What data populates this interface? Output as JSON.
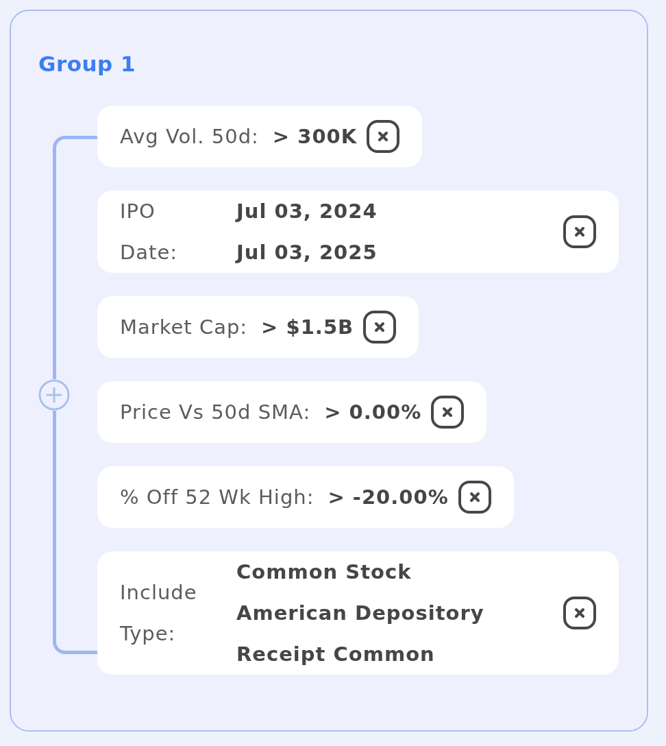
{
  "group": {
    "title": "Group 1",
    "filters": [
      {
        "label": "Avg Vol. 50d:",
        "values": [
          "> 300K"
        ]
      },
      {
        "label": "IPO Date:",
        "values": [
          "Jul 03, 2024",
          "Jul 03, 2025"
        ]
      },
      {
        "label": "Market Cap:",
        "values": [
          "> $1.5B"
        ]
      },
      {
        "label": "Price Vs 50d SMA:",
        "values": [
          "> 0.00%"
        ]
      },
      {
        "label": "% Off 52 Wk High:",
        "values": [
          "> -20.00%"
        ]
      },
      {
        "label": "Include Type:",
        "values": [
          "Common Stock",
          "American Depository Receipt Common"
        ]
      }
    ]
  }
}
